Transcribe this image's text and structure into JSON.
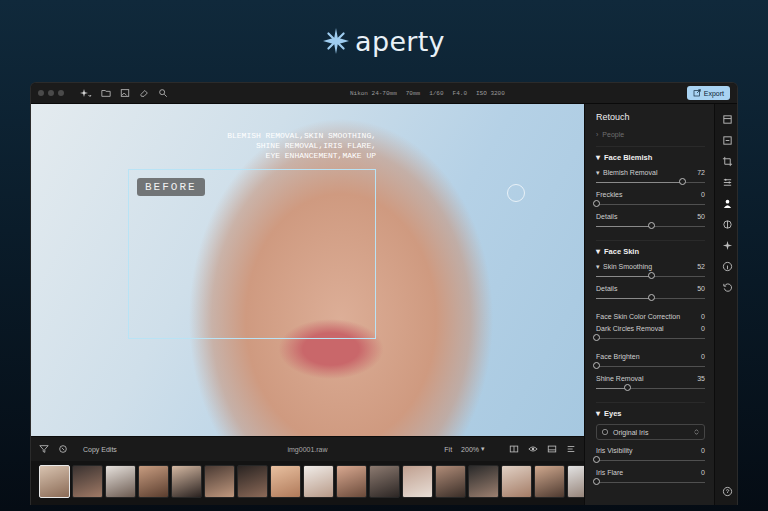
{
  "logo": {
    "text": "aperty"
  },
  "toolbar": {
    "camera_info": [
      "Nikon 24-70mm",
      "70mm",
      "1/60",
      "F4.0",
      "ISO 3200"
    ],
    "export_button": "Export"
  },
  "photo": {
    "caption": [
      "BLEMISH REMOVAL,SKIN SMOOTHING,",
      "SHINE REMOVAL,IRIS FLARE,",
      "EYE ENHANCEMENT,MAKE UP"
    ],
    "before_badge": "BEFORE"
  },
  "panel": {
    "title": "Retouch",
    "people": {
      "caret": "›",
      "label": "People",
      "disabled": true
    },
    "sections": [
      {
        "caret": "▾",
        "title": "Face Blemish",
        "groups": [
          [
            {
              "kind": "slider",
              "caret": "▾",
              "label": "Blemish Removal",
              "value": "72",
              "level": 0.79
            },
            {
              "kind": "slider",
              "label": "Freckles",
              "value": "0",
              "level": 0
            },
            {
              "kind": "slider",
              "label": "Details",
              "value": "50",
              "level": 0.5
            }
          ]
        ]
      },
      {
        "caret": "▾",
        "title": "Face Skin",
        "groups": [
          [
            {
              "kind": "slider",
              "caret": "▾",
              "label": "Skin Smoothing",
              "value": "52",
              "level": 0.5
            },
            {
              "kind": "slider",
              "label": "Details",
              "value": "50",
              "level": 0.5
            }
          ],
          [
            {
              "kind": "value",
              "label": "Face Skin Color Correction",
              "value": "0"
            },
            {
              "kind": "slider",
              "label": "Dark Circles Removal",
              "value": "0",
              "level": 0
            }
          ],
          [
            {
              "kind": "slider",
              "label": "Face Brighten",
              "value": "0",
              "level": 0
            },
            {
              "kind": "slider",
              "label": "Shine Removal",
              "value": "35",
              "level": 0.28
            }
          ]
        ]
      },
      {
        "caret": "▾",
        "title": "Eyes",
        "groups": [
          [
            {
              "kind": "dropdown",
              "label": "Original Iris"
            },
            {
              "kind": "slider",
              "label": "Iris Visibility",
              "value": "0",
              "level": 0
            },
            {
              "kind": "slider",
              "label": "Iris Flare",
              "value": "0",
              "level": 0
            }
          ]
        ]
      }
    ]
  },
  "bottom_bar": {
    "copy_edits": "Copy Edits",
    "filename": "img0001.raw",
    "fit": "Fit",
    "zoom": "200%",
    "zoom_caret": "▾"
  },
  "filmstrip": {
    "thumbnails": [
      {
        "selected": true
      },
      {
        "selected": false
      },
      {
        "selected": false
      },
      {
        "selected": false
      },
      {
        "selected": false
      },
      {
        "selected": false
      },
      {
        "selected": false
      },
      {
        "selected": false
      },
      {
        "selected": false
      },
      {
        "selected": false
      },
      {
        "selected": false
      },
      {
        "selected": false
      },
      {
        "selected": false
      },
      {
        "selected": false
      },
      {
        "selected": false
      },
      {
        "selected": false
      },
      {
        "selected": false
      }
    ]
  }
}
